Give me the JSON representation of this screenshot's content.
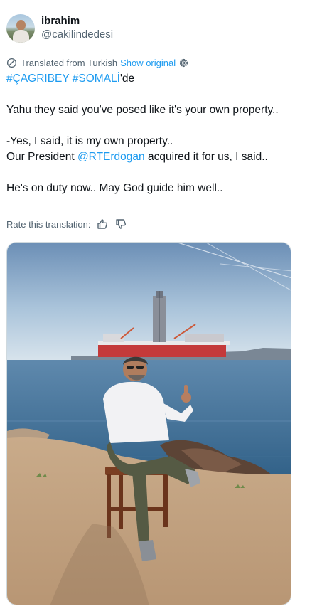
{
  "user": {
    "display_name": "ibrahim",
    "handle": "@cakilindedesi"
  },
  "translation": {
    "label": "Translated from Turkish",
    "show_original": "Show original",
    "rate_label": "Rate this translation:"
  },
  "tweet": {
    "hashtag1": "#ÇAGRIBEY",
    "hashtag2": "#SOMALİ",
    "hashtag_suffix": "'de",
    "line1": "Yahu they said you've posed like it's your own property..",
    "line2": "-Yes, I said, it is my own property..",
    "line3_prefix": "Our President ",
    "mention": "@RTErdogan",
    "line3_suffix": " acquired it for us, I said..",
    "line4": "He's on duty now.. May God guide him well.."
  },
  "icons": {
    "translate": "translate-icon",
    "settings": "gear-icon",
    "thumbs_up": "thumbs-up-icon",
    "thumbs_down": "thumbs-down-icon"
  },
  "colors": {
    "link": "#1d9bf0",
    "secondary_text": "#536471",
    "primary_text": "#0f1419"
  }
}
